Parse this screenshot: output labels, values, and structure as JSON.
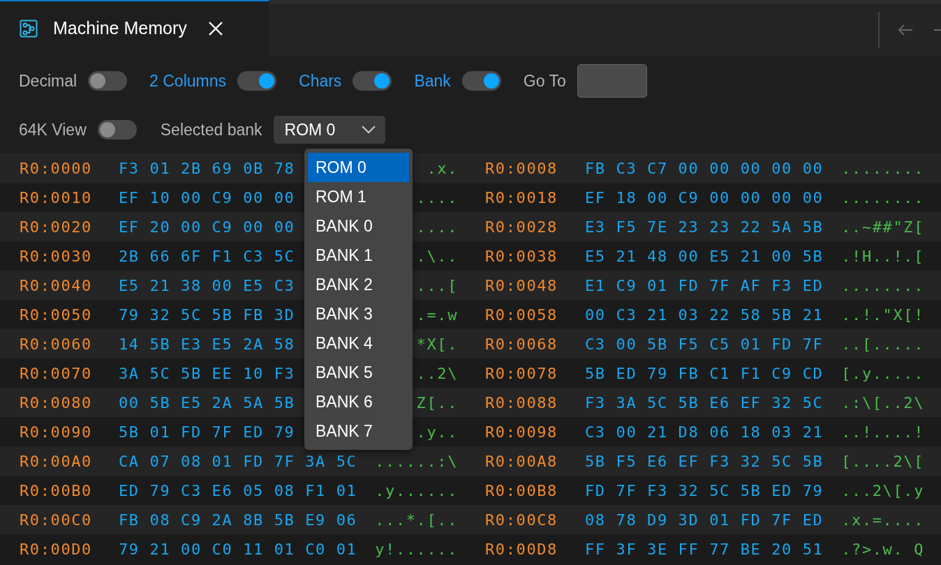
{
  "tab": {
    "title": "Machine Memory",
    "selected": true
  },
  "toggles": [
    {
      "label": "Decimal",
      "on": false
    },
    {
      "label": "2 Columns",
      "on": true
    },
    {
      "label": "Chars",
      "on": true
    },
    {
      "label": "Bank",
      "on": true
    }
  ],
  "go_to": {
    "label": "Go To"
  },
  "view_64k": {
    "label": "64K View",
    "on": false
  },
  "bank_select": {
    "label": "Selected bank",
    "value": "ROM 0",
    "expanded": true,
    "options": [
      {
        "label": "ROM 0",
        "selected": true
      },
      {
        "label": "ROM 1",
        "selected": false
      },
      {
        "label": "BANK 0",
        "selected": false
      },
      {
        "label": "BANK 1",
        "selected": false
      },
      {
        "label": "BANK 2",
        "selected": false
      },
      {
        "label": "BANK 3",
        "selected": false
      },
      {
        "label": "BANK 4",
        "selected": false
      },
      {
        "label": "BANK 5",
        "selected": false
      },
      {
        "label": "BANK 6",
        "selected": false
      },
      {
        "label": "BANK 7",
        "selected": false
      }
    ]
  },
  "rows": [
    {
      "left": {
        "address": "R0:0000",
        "bytes": [
          "F3",
          "01",
          "2B",
          "69",
          "0B",
          "78"
        ],
        "chars": ".x."
      },
      "right": {
        "address": "R0:0008",
        "bytes": [
          "FB",
          "C3",
          "C7",
          "00",
          "00",
          "00",
          "00",
          "00"
        ],
        "chars": "........"
      }
    },
    {
      "left": {
        "address": "R0:0010",
        "bytes": [
          "EF",
          "10",
          "00",
          "C9",
          "00",
          "00"
        ],
        "chars": "...."
      },
      "right": {
        "address": "R0:0018",
        "bytes": [
          "EF",
          "18",
          "00",
          "C9",
          "00",
          "00",
          "00",
          "00"
        ],
        "chars": "........"
      }
    },
    {
      "left": {
        "address": "R0:0020",
        "bytes": [
          "EF",
          "20",
          "00",
          "C9",
          "00",
          "00"
        ],
        "chars": "...."
      },
      "right": {
        "address": "R0:0028",
        "bytes": [
          "E3",
          "F5",
          "7E",
          "23",
          "23",
          "22",
          "5A",
          "5B"
        ],
        "chars": "..~##\"Z["
      }
    },
    {
      "left": {
        "address": "R0:0030",
        "bytes": [
          "2B",
          "66",
          "6F",
          "F1",
          "C3",
          "5C"
        ],
        "chars": ".\\.."
      },
      "right": {
        "address": "R0:0038",
        "bytes": [
          "E5",
          "21",
          "48",
          "00",
          "E5",
          "21",
          "00",
          "5B"
        ],
        "chars": ".!H..!.["
      }
    },
    {
      "left": {
        "address": "R0:0040",
        "bytes": [
          "E5",
          "21",
          "38",
          "00",
          "E5",
          "C3"
        ],
        "chars": "...["
      },
      "right": {
        "address": "R0:0048",
        "bytes": [
          "E1",
          "C9",
          "01",
          "FD",
          "7F",
          "AF",
          "F3",
          "ED"
        ],
        "chars": "........"
      }
    },
    {
      "left": {
        "address": "R0:0050",
        "bytes": [
          "79",
          "32",
          "5C",
          "5B",
          "FB",
          "3D"
        ],
        "chars": ".=.w"
      },
      "right": {
        "address": "R0:0058",
        "bytes": [
          "00",
          "C3",
          "21",
          "03",
          "22",
          "58",
          "5B",
          "21"
        ],
        "chars": "..!.\"X[!"
      }
    },
    {
      "left": {
        "address": "R0:0060",
        "bytes": [
          "14",
          "5B",
          "E3",
          "E5",
          "2A",
          "58"
        ],
        "chars": "*X[."
      },
      "right": {
        "address": "R0:0068",
        "bytes": [
          "C3",
          "00",
          "5B",
          "F5",
          "C5",
          "01",
          "FD",
          "7F"
        ],
        "chars": "..[....."
      }
    },
    {
      "left": {
        "address": "R0:0070",
        "bytes": [
          "3A",
          "5C",
          "5B",
          "EE",
          "10",
          "F3"
        ],
        "chars": "..2\\"
      },
      "right": {
        "address": "R0:0078",
        "bytes": [
          "5B",
          "ED",
          "79",
          "FB",
          "C1",
          "F1",
          "C9",
          "CD"
        ],
        "chars": "[.y....."
      }
    },
    {
      "left": {
        "address": "R0:0080",
        "bytes": [
          "00",
          "5B",
          "E5",
          "2A",
          "5A",
          "5B"
        ],
        "chars": "Z[.."
      },
      "right": {
        "address": "R0:0088",
        "bytes": [
          "F3",
          "3A",
          "5C",
          "5B",
          "E6",
          "EF",
          "32",
          "5C"
        ],
        "chars": ".:\\[..2\\"
      }
    },
    {
      "left": {
        "address": "R0:0090",
        "bytes": [
          "5B",
          "01",
          "FD",
          "7F",
          "ED",
          "79"
        ],
        "chars": ".y.."
      },
      "right": {
        "address": "R0:0098",
        "bytes": [
          "C3",
          "00",
          "21",
          "D8",
          "06",
          "18",
          "03",
          "21"
        ],
        "chars": "..!....!"
      }
    },
    {
      "left": {
        "address": "R0:00A0",
        "bytes": [
          "CA",
          "07",
          "08",
          "01",
          "FD",
          "7F",
          "3A",
          "5C"
        ],
        "chars": "......:\\"
      },
      "right": {
        "address": "R0:00A8",
        "bytes": [
          "5B",
          "F5",
          "E6",
          "EF",
          "F3",
          "32",
          "5C",
          "5B"
        ],
        "chars": "[....2\\["
      }
    },
    {
      "left": {
        "address": "R0:00B0",
        "bytes": [
          "ED",
          "79",
          "C3",
          "E6",
          "05",
          "08",
          "F1",
          "01"
        ],
        "chars": ".y......"
      },
      "right": {
        "address": "R0:00B8",
        "bytes": [
          "FD",
          "7F",
          "F3",
          "32",
          "5C",
          "5B",
          "ED",
          "79"
        ],
        "chars": "...2\\[.y"
      }
    },
    {
      "left": {
        "address": "R0:00C0",
        "bytes": [
          "FB",
          "08",
          "C9",
          "2A",
          "8B",
          "5B",
          "E9",
          "06"
        ],
        "chars": "...*.[.."
      },
      "right": {
        "address": "R0:00C8",
        "bytes": [
          "08",
          "78",
          "D9",
          "3D",
          "01",
          "FD",
          "7F",
          "ED"
        ],
        "chars": ".x.=...."
      }
    },
    {
      "left": {
        "address": "R0:00D0",
        "bytes": [
          "79",
          "21",
          "00",
          "C0",
          "11",
          "01",
          "C0",
          "01"
        ],
        "chars": "y!......"
      },
      "right": {
        "address": "R0:00D8",
        "bytes": [
          "FF",
          "3F",
          "3E",
          "FF",
          "77",
          "BE",
          "20",
          "51"
        ],
        "chars": ".?>.w. Q"
      }
    }
  ]
}
